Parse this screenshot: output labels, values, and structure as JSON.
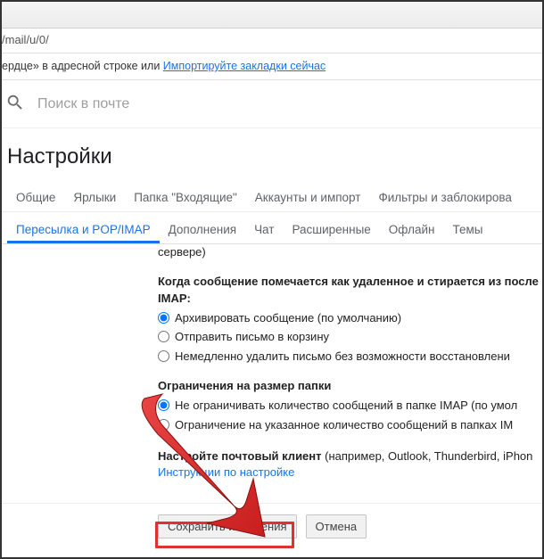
{
  "browser": {
    "url_fragment": "/mail/u/0/",
    "bookmark_hint_prefix": "ердце» в адресной строке или ",
    "bookmark_link": "Импортируйте закладки сейчас"
  },
  "search": {
    "placeholder": "Поиск в почте"
  },
  "title": "Настройки",
  "tabs_row1": {
    "t0": "Общие",
    "t1": "Ярлыки",
    "t2": "Папка \"Входящие\"",
    "t3": "Аккаунты и импорт",
    "t4": "Фильтры и заблокирова"
  },
  "tabs_row2": {
    "t0": "Пересылка и POP/IMAP",
    "t1": "Дополнения",
    "t2": "Чат",
    "t3": "Расширенные",
    "t4": "Офлайн",
    "t5": "Темы"
  },
  "content": {
    "server_fragment": "сервере)",
    "del_heading": "Когда сообщение помечается как удаленное и стирается из после IMAP:",
    "del_opt1": "Архивировать сообщение (по умолчанию)",
    "del_opt2": "Отправить письмо в корзину",
    "del_opt3": "Немедленно удалить письмо без возможности восстановлени",
    "limit_heading": "Ограничения на размер папки",
    "limit_opt1": "Не ограничивать количество сообщений в папке IMAP (по умол",
    "limit_opt2": "Ограничение на указанное количество сообщений в папках IM",
    "client_prefix": "Настройте почтовый клиент",
    "client_suffix": " (например, Outlook, Thunderbird, iPhon",
    "client_link": "Инструкции по настройке"
  },
  "buttons": {
    "save": "Сохранить изменения",
    "cancel": "Отмена"
  },
  "annotation": {
    "arrow_color": "#e03030"
  }
}
